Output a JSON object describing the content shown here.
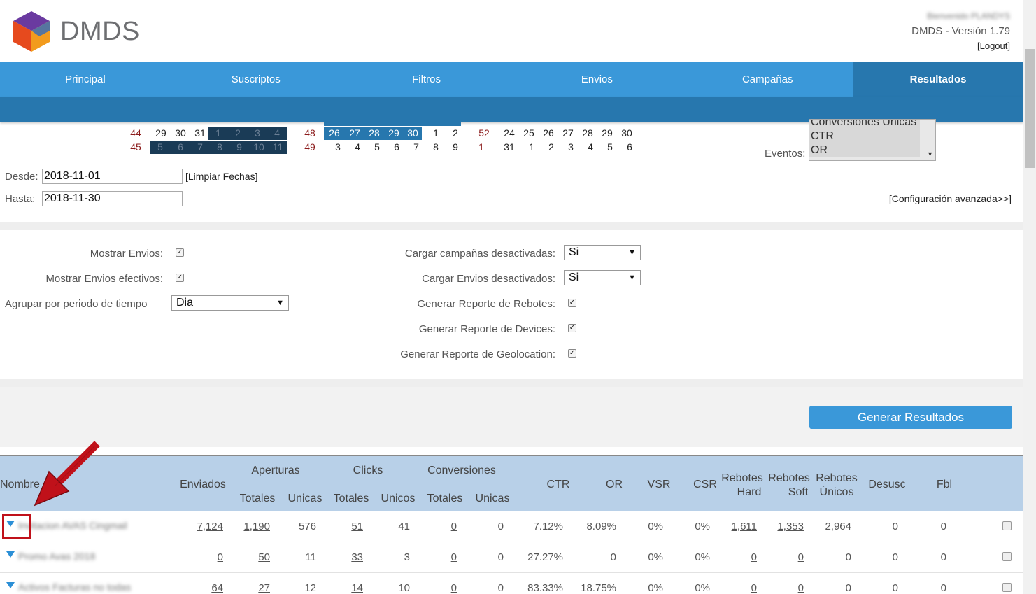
{
  "header": {
    "brand": "DMDS",
    "welcome": "Bienvenido PLANDYS",
    "version": "DMDS - Versión 1.79",
    "logout": "[Logout]"
  },
  "nav": {
    "items": [
      "Principal",
      "Suscriptos",
      "Filtros",
      "Envios",
      "Campañas",
      "Resultados"
    ],
    "active": "Resultados"
  },
  "calendar": {
    "rows": [
      {
        "week1": "44",
        "days1": [
          "29",
          "30",
          "31",
          "1",
          "2",
          "3",
          "4"
        ],
        "week2": "48",
        "days2": [
          "26",
          "27",
          "28",
          "29",
          "30",
          "1",
          "2"
        ],
        "week3": "52",
        "days3": [
          "24",
          "25",
          "26",
          "27",
          "28",
          "29",
          "30"
        ]
      },
      {
        "week1": "45",
        "days1": [
          "5",
          "6",
          "7",
          "8",
          "9",
          "10",
          "11"
        ],
        "week2": "49",
        "days2": [
          "3",
          "4",
          "5",
          "6",
          "7",
          "8",
          "9"
        ],
        "week3": "1",
        "days3": [
          "31",
          "1",
          "2",
          "3",
          "4",
          "5",
          "6"
        ]
      }
    ]
  },
  "dates": {
    "desde_label": "Desde:",
    "desde_value": "2018-11-01",
    "hasta_label": "Hasta:",
    "hasta_value": "2018-11-30",
    "clear": "[Limpiar Fechas]",
    "advanced": "[Configuración avanzada>>]"
  },
  "eventos": {
    "label": "Eventos:",
    "options": [
      "Conversiones Unicas",
      "CTR",
      "OR"
    ]
  },
  "options": {
    "mostrar_envios": "Mostrar Envios:",
    "mostrar_envios_efectivos": "Mostrar Envios efectivos:",
    "agrupar": "Agrupar por periodo de tiempo",
    "agrupar_value": "Dia",
    "cargar_campanas": "Cargar campañas desactivadas:",
    "cargar_campanas_value": "Si",
    "cargar_envios": "Cargar Envios desactivados:",
    "cargar_envios_value": "Si",
    "rebotes": "Generar Reporte de Rebotes:",
    "devices": "Generar Reporte de Devices:",
    "geolocation": "Generar Reporte de Geolocation:"
  },
  "generate_button": "Generar Resultados",
  "table": {
    "headers": {
      "nombre": "Nombre",
      "enviados": "Enviados",
      "aperturas": "Aperturas",
      "clicks": "Clicks",
      "conversiones": "Conversiones",
      "totales": "Totales",
      "unicas": "Unicas",
      "unicos": "Unicos",
      "ctr": "CTR",
      "or": "OR",
      "vsr": "VSR",
      "csr": "CSR",
      "rebotes_hard_1": "Rebotes",
      "rebotes_hard_2": "Hard",
      "rebotes_soft_1": "Rebotes",
      "rebotes_soft_2": "Soft",
      "rebotes_unicos_1": "Rebotes",
      "rebotes_unicos_2": "Únicos",
      "desusc": "Desusc",
      "fbl": "Fbl"
    },
    "rows": [
      {
        "name": "Invitacion AVAS Cingmail",
        "enviados": "7,124",
        "ap_tot": "1,190",
        "ap_uni": "576",
        "cl_tot": "51",
        "cl_uni": "41",
        "co_tot": "0",
        "co_uni": "0",
        "ctr": "7.12%",
        "or": "8.09%",
        "vsr": "0%",
        "csr": "0%",
        "rh": "1,611",
        "rs": "1,353",
        "ru": "2,964",
        "desusc": "0",
        "fbl": "0"
      },
      {
        "name": "Promo Avas 2018",
        "enviados": "0",
        "ap_tot": "50",
        "ap_uni": "11",
        "cl_tot": "33",
        "cl_uni": "3",
        "co_tot": "0",
        "co_uni": "0",
        "ctr": "27.27%",
        "or": "0",
        "vsr": "0%",
        "csr": "0%",
        "rh": "0",
        "rs": "0",
        "ru": "0",
        "desusc": "0",
        "fbl": "0"
      },
      {
        "name": "Activos Facturas no todas",
        "enviados": "64",
        "ap_tot": "27",
        "ap_uni": "12",
        "cl_tot": "14",
        "cl_uni": "10",
        "co_tot": "0",
        "co_uni": "0",
        "ctr": "83.33%",
        "or": "18.75%",
        "vsr": "0%",
        "csr": "0%",
        "rh": "0",
        "rs": "0",
        "ru": "0",
        "desusc": "0",
        "fbl": "0"
      }
    ]
  },
  "colors": {
    "nav": "#3a98d9",
    "nav_active": "#2777ae",
    "table_header": "#b8d0e8",
    "highlight": "#c0111a"
  }
}
